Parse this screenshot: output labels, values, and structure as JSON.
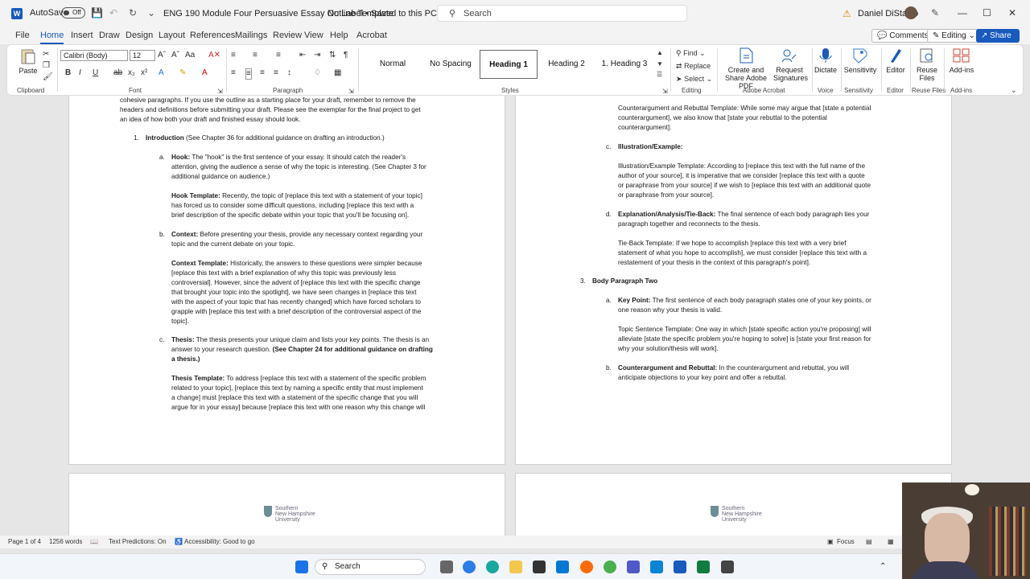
{
  "titlebar": {
    "autosave_label": "AutoSave",
    "autosave_state": "Off",
    "document_title": "ENG 190 Module Four Persuasive Essay Outline Template",
    "save_status": "No Label • Saved to this PC",
    "search_placeholder": "Search",
    "user_name": "Daniel DiStasio"
  },
  "tabs": [
    "File",
    "Home",
    "Insert",
    "Draw",
    "Design",
    "Layout",
    "References",
    "Mailings",
    "Review",
    "View",
    "Help",
    "Acrobat"
  ],
  "tab_buttons": {
    "comments": "Comments",
    "editing": "Editing",
    "share": "Share"
  },
  "ribbon": {
    "paste": "Paste",
    "clipboard": "Clipboard",
    "font_name": "Calibri (Body)",
    "font_size": "12",
    "font": "Font",
    "paragraph": "Paragraph",
    "styles_label": "Styles",
    "styles": [
      "Normal",
      "No Spacing",
      "Heading 1",
      "Heading 2",
      "1.  Heading 3"
    ],
    "find": "Find",
    "replace": "Replace",
    "select": "Select",
    "editing": "Editing",
    "adobe_create": "Create and Share Adobe PDF",
    "adobe_request": "Request Signatures",
    "adobe_group": "Adobe Acrobat",
    "dictate": "Dictate",
    "voice": "Voice",
    "sensitivity": "Sensitivity",
    "editor": "Editor",
    "reuse_files": "Reuse Files",
    "addins": "Add-ins"
  },
  "left_page": {
    "intro_1": "cohesive paragraphs. If you use the outline as a starting place for your draft, remember to remove the",
    "intro_2": "headers and definitions before submitting your draft. Please see the exemplar for the final project to get",
    "intro_3": "an idea of how both your draft and finished essay should look.",
    "item1_num": "1.",
    "item1_title": "Introduction",
    "item1_rest": " (See Chapter 36 for additional guidance on drafting an introduction.)",
    "a_label": "a.",
    "hook_1_b": "Hook:",
    "hook_1": " The \"hook\" is the first sentence of your essay. It should catch the reader's",
    "hook_2": "attention, giving the audience a sense of why the topic is interesting. (See Chapter 3 for",
    "hook_3": "additional guidance on audience.)",
    "hookt_1_b": "Hook Template:",
    "hookt_1": " Recently, the topic of [replace this text with a statement of your topic]",
    "hookt_2": "has forced us to consider some difficult questions, including [replace this text with a",
    "hookt_3": "brief description of the specific debate within your topic that you'll be focusing on].",
    "b_label": "b.",
    "ctx_1_b": "Context:",
    "ctx_1": " Before presenting your thesis, provide any necessary context regarding your",
    "ctx_2": "topic and the current debate on your topic.",
    "ctxt_1_b": "Context Template:",
    "ctxt_1": " Historically, the answers to these questions were simpler because",
    "ctxt_2": "[replace this text with a brief explanation of why this topic was previously less",
    "ctxt_3": "controversial]. However, since the advent of [replace this text with the specific change",
    "ctxt_4": "that brought your topic into the spotlight], we have seen changes in [replace this text",
    "ctxt_5": "with the aspect of your topic that has recently changed] which have forced scholars to",
    "ctxt_6": "grapple with [replace this text with a brief description of the controversial aspect of the",
    "ctxt_7": "topic].",
    "c_label": "c.",
    "th_1_b": "Thesis:",
    "th_1": " The thesis presents your unique claim and lists your key points. The thesis is an",
    "th_2": "answer to your research question. ",
    "th_2_b": "(See Chapter 24 for additional guidance on drafting",
    "th_3_b": "a thesis.)",
    "tht_1_b": "Thesis Template:",
    "tht_1": " To address [replace this text with a statement of the specific problem",
    "tht_2": "related to your topic], [replace this text by naming a specific entity that must implement",
    "tht_3": "a change] must [replace this text with a statement of the specific change that you will",
    "tht_4": "argue for in your essay] because [replace this text with one reason why this change will"
  },
  "right_page": {
    "cr_1": "Counterargument and Rebuttal Template: While some may argue that [state a potential",
    "cr_2": "counterargument], we also know that [state your rebuttal to the potential",
    "cr_3": "counterargument].",
    "c_label": "c.",
    "ill_b": "Illustration/Example:",
    "ill_1": "Illustration/Example Template: According to [replace this text with the full name of the",
    "ill_2": "author of your source], it is imperative that we consider [replace this text with a quote",
    "ill_3": "or paraphrase from your source] if we wish to [replace this text with an additional quote",
    "ill_4": "or paraphrase from your source].",
    "d_label": "d.",
    "exp_1_b": "Explanation/Analysis/Tie-Back:",
    "exp_1": " The final sentence of each body paragraph ties your",
    "exp_2": "paragraph together and reconnects to the thesis.",
    "tb_1": "Tie-Back Template: If we hope to accomplish [replace this text with a very brief",
    "tb_2": "statement of what you hope to accomplish], we must consider [replace this text with a",
    "tb_3": "restatement of your thesis in the context of this paragraph's point].",
    "item3_num": "3.",
    "item3_title": "Body Paragraph Two",
    "a_label": "a.",
    "kp_1_b": "Key Point:",
    "kp_1": " The first sentence of each body paragraph states one of your key points, or",
    "kp_2": "one reason why your thesis is valid.",
    "ts_1": "Topic Sentence Template: One way in which [state specific action you're proposing] will",
    "ts_2": "alleviate [state the specific problem you're hoping to solve] is [state your first reason for",
    "ts_3": "why your solution/thesis will work].",
    "b_label": "b.",
    "car_1_b": "Counterargument and Rebuttal:",
    "car_1": " In the counterargument and rebuttal, you will",
    "car_2": "anticipate objections to your key point and offer a rebuttal."
  },
  "logo_text": [
    "Southern",
    "New Hampshire",
    "University"
  ],
  "statusbar": {
    "page": "Page 1 of 4",
    "words": "1256 words",
    "predictions": "Text Predictions: On",
    "accessibility": "Accessibility: Good to go",
    "focus": "Focus"
  },
  "taskbar": {
    "search": "Search"
  }
}
